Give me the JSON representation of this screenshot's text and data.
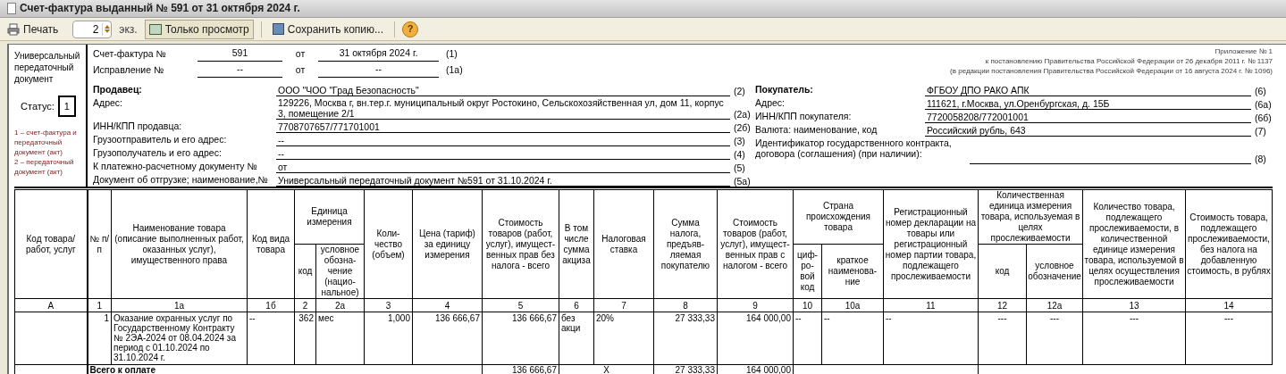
{
  "window": {
    "title": "Счет-фактура выданный № 591 от 31 октября 2024 г."
  },
  "toolbar": [
    {
      "kind": "print",
      "label": "Печать"
    },
    {
      "kind": "spinner",
      "value": "2"
    },
    {
      "kind": "text",
      "label": "экз."
    },
    {
      "kind": "toggle",
      "label": "Только просмотр",
      "on": true
    },
    {
      "kind": "save",
      "label": "Сохранить копию..."
    },
    {
      "kind": "help",
      "label": "?"
    }
  ],
  "document": {
    "left_panel": {
      "title": "Универсальный передаточный документ",
      "status_label": "Статус:",
      "status_value": "1",
      "legend": [
        "1 – счет-фактура и передаточный документ (акт)",
        "2 – передаточный документ (акт)"
      ]
    },
    "appendix": [
      "Приложение № 1",
      "к постановлению Правительства Российской Федерации от 26 декабря 2011 г. № 1137",
      "(в редакции постановления Правительства Российской Федерации от 16 августа 2024 г. № 1096)"
    ],
    "invoice_lines": [
      {
        "label": "Счет-фактура №",
        "number": "591",
        "date_label": "от",
        "date": "31 октября 2024 г.",
        "code": "(1)"
      },
      {
        "label": "Исправление №",
        "number": "--",
        "date_label": "от",
        "date": "--",
        "code": "(1а)"
      }
    ],
    "seller": [
      {
        "kind": "heading",
        "label": "Продавец:",
        "value": "ООО \"ЧОО \"Град Безопасность\"",
        "code": "(2)"
      },
      {
        "kind": "field",
        "label": "Адрес:",
        "value": "129226, Москва г, вн.тер.г. муниципальный округ Ростокино, Сельскохозяйственная ул, дом 11, корпус 3, помещение 2/1",
        "code": "(2а)"
      },
      {
        "kind": "field",
        "label": "ИНН/КПП продавца:",
        "value": "7708707657/771701001",
        "code": "(2б)"
      },
      {
        "kind": "field",
        "label": "Грузоотправитель и его адрес:",
        "value": "--",
        "code": "(3)"
      },
      {
        "kind": "field",
        "label": "Грузополучатель и его адрес:",
        "value": "--",
        "code": "(4)"
      },
      {
        "kind": "field",
        "label": "К платежно-расчетному документу №",
        "value": "от",
        "code": "(5)"
      },
      {
        "kind": "field",
        "label": "Документ об отгрузке; наименование,№",
        "value": "Универсальный передаточный документ №591 от 31.10.2024 г.",
        "code": "(5а)"
      }
    ],
    "buyer": [
      {
        "kind": "heading",
        "label": "Покупатель:",
        "value": "ФГБОУ ДПО РАКО АПК",
        "code": "(6)"
      },
      {
        "kind": "field",
        "label": "Адрес:",
        "value": "111621, г.Москва, ул.Оренбургская, д. 15Б",
        "code": "(6а)"
      },
      {
        "kind": "field",
        "label": "ИНН/КПП покупателя:",
        "value": "7720058208/772001001",
        "code": "(6б)"
      },
      {
        "kind": "field",
        "label": "Валюта: наименование, код",
        "value": "Российский рубль, 643",
        "code": "(7)"
      },
      {
        "kind": "field",
        "label": "Идентификатор государственного контракта, договора (соглашения) (при наличии):",
        "code": "(8)"
      }
    ],
    "table": {
      "columns": [
        {
          "label": "Код товара/ работ, услуг",
          "number": "А"
        },
        {
          "label": "№ п/п",
          "number": "1"
        },
        {
          "label": "Наименование товара (описание выполненных работ, оказанных услуг), имущественного права",
          "number": "1а"
        },
        {
          "label": "Код вида товара",
          "number": "1б"
        },
        {
          "label": "Единица измерения",
          "colspan": 2,
          "children": [
            {
              "label": "код",
              "number": "2"
            },
            {
              "label": "условное обозна- чение (нацио- нальное)",
              "number": "2а"
            }
          ]
        },
        {
          "label": "Коли- чество (объем)",
          "number": "3"
        },
        {
          "label": "Цена (тариф) за единицу измерения",
          "number": "4"
        },
        {
          "label": "Стоимость товаров (работ, услуг), имущест- венных прав без налога - всего",
          "number": "5"
        },
        {
          "label": "В том числе сумма акциза",
          "number": "6"
        },
        {
          "label": "Налоговая ставка",
          "number": "7"
        },
        {
          "label": "Сумма налога, предъяв- ляемая покупателю",
          "number": "8"
        },
        {
          "label": "Стоимость товаров (работ, услуг), имущест- венных прав с налогом - всего",
          "number": "9"
        },
        {
          "label": "Страна происхождения товара",
          "colspan": 2,
          "children": [
            {
              "label": "циф- ро- вой код",
              "number": "10"
            },
            {
              "label": "краткое наименова- ние",
              "number": "10а"
            }
          ]
        },
        {
          "label": "Регистрационный номер декларации на товары или регистрационный номер партии товара, подлежащего прослеживаемости",
          "number": "11"
        },
        {
          "label": "Количественная единица измерения товара, используемая в целях прослеживаемости",
          "colspan": 2,
          "children": [
            {
              "label": "код",
              "number": "12"
            },
            {
              "label": "условное обозначение",
              "number": "12а"
            }
          ]
        },
        {
          "label": "Количество товара, подлежащего прослеживаемости, в количественной единице измерения товара, используемой в целях осуществления прослеживаемости",
          "number": "13"
        },
        {
          "label": "Стоимость товара, подлежащего прослеживаемости, без налога на добавленную стоимость, в рублях",
          "number": "14"
        }
      ],
      "rows": [
        {
          "cells": [
            "",
            "1",
            "Оказание охранных услуг по Государственному Контракту № 2ЭА-2024 от 08.04.2024  за период с 01.10.2024 по 31.10.2024 г.",
            "--",
            "362",
            "мес",
            "1,000",
            "136 666,67",
            "136 666,67",
            "без акци",
            "20%",
            "27 333,33",
            "164 000,00",
            "--",
            "--",
            "--",
            "---",
            "---",
            "---",
            "---"
          ]
        }
      ],
      "totals": {
        "label": "Всего к оплате",
        "cost_without_tax": "136 666,67",
        "excise": "X",
        "tax_amount": "27 333,33",
        "cost_with_tax": "164 000,00"
      }
    }
  }
}
